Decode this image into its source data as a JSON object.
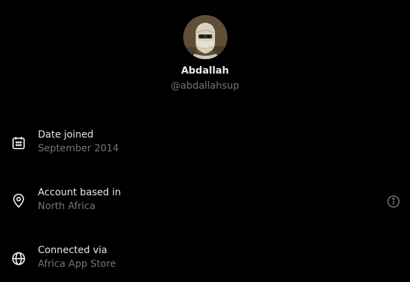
{
  "profile": {
    "display_name": "Abdallah",
    "handle": "@abdallahsup"
  },
  "details": [
    {
      "icon": "calendar-icon",
      "label": "Date joined",
      "value": "September 2014"
    },
    {
      "icon": "location-pin-icon",
      "label": "Account based in",
      "value": "North Africa"
    },
    {
      "icon": "globe-icon",
      "label": "Connected via",
      "value": "Africa App Store"
    }
  ],
  "colors": {
    "background": "#000000",
    "primary_text": "#e7e9ea",
    "secondary_text": "#71767b"
  }
}
